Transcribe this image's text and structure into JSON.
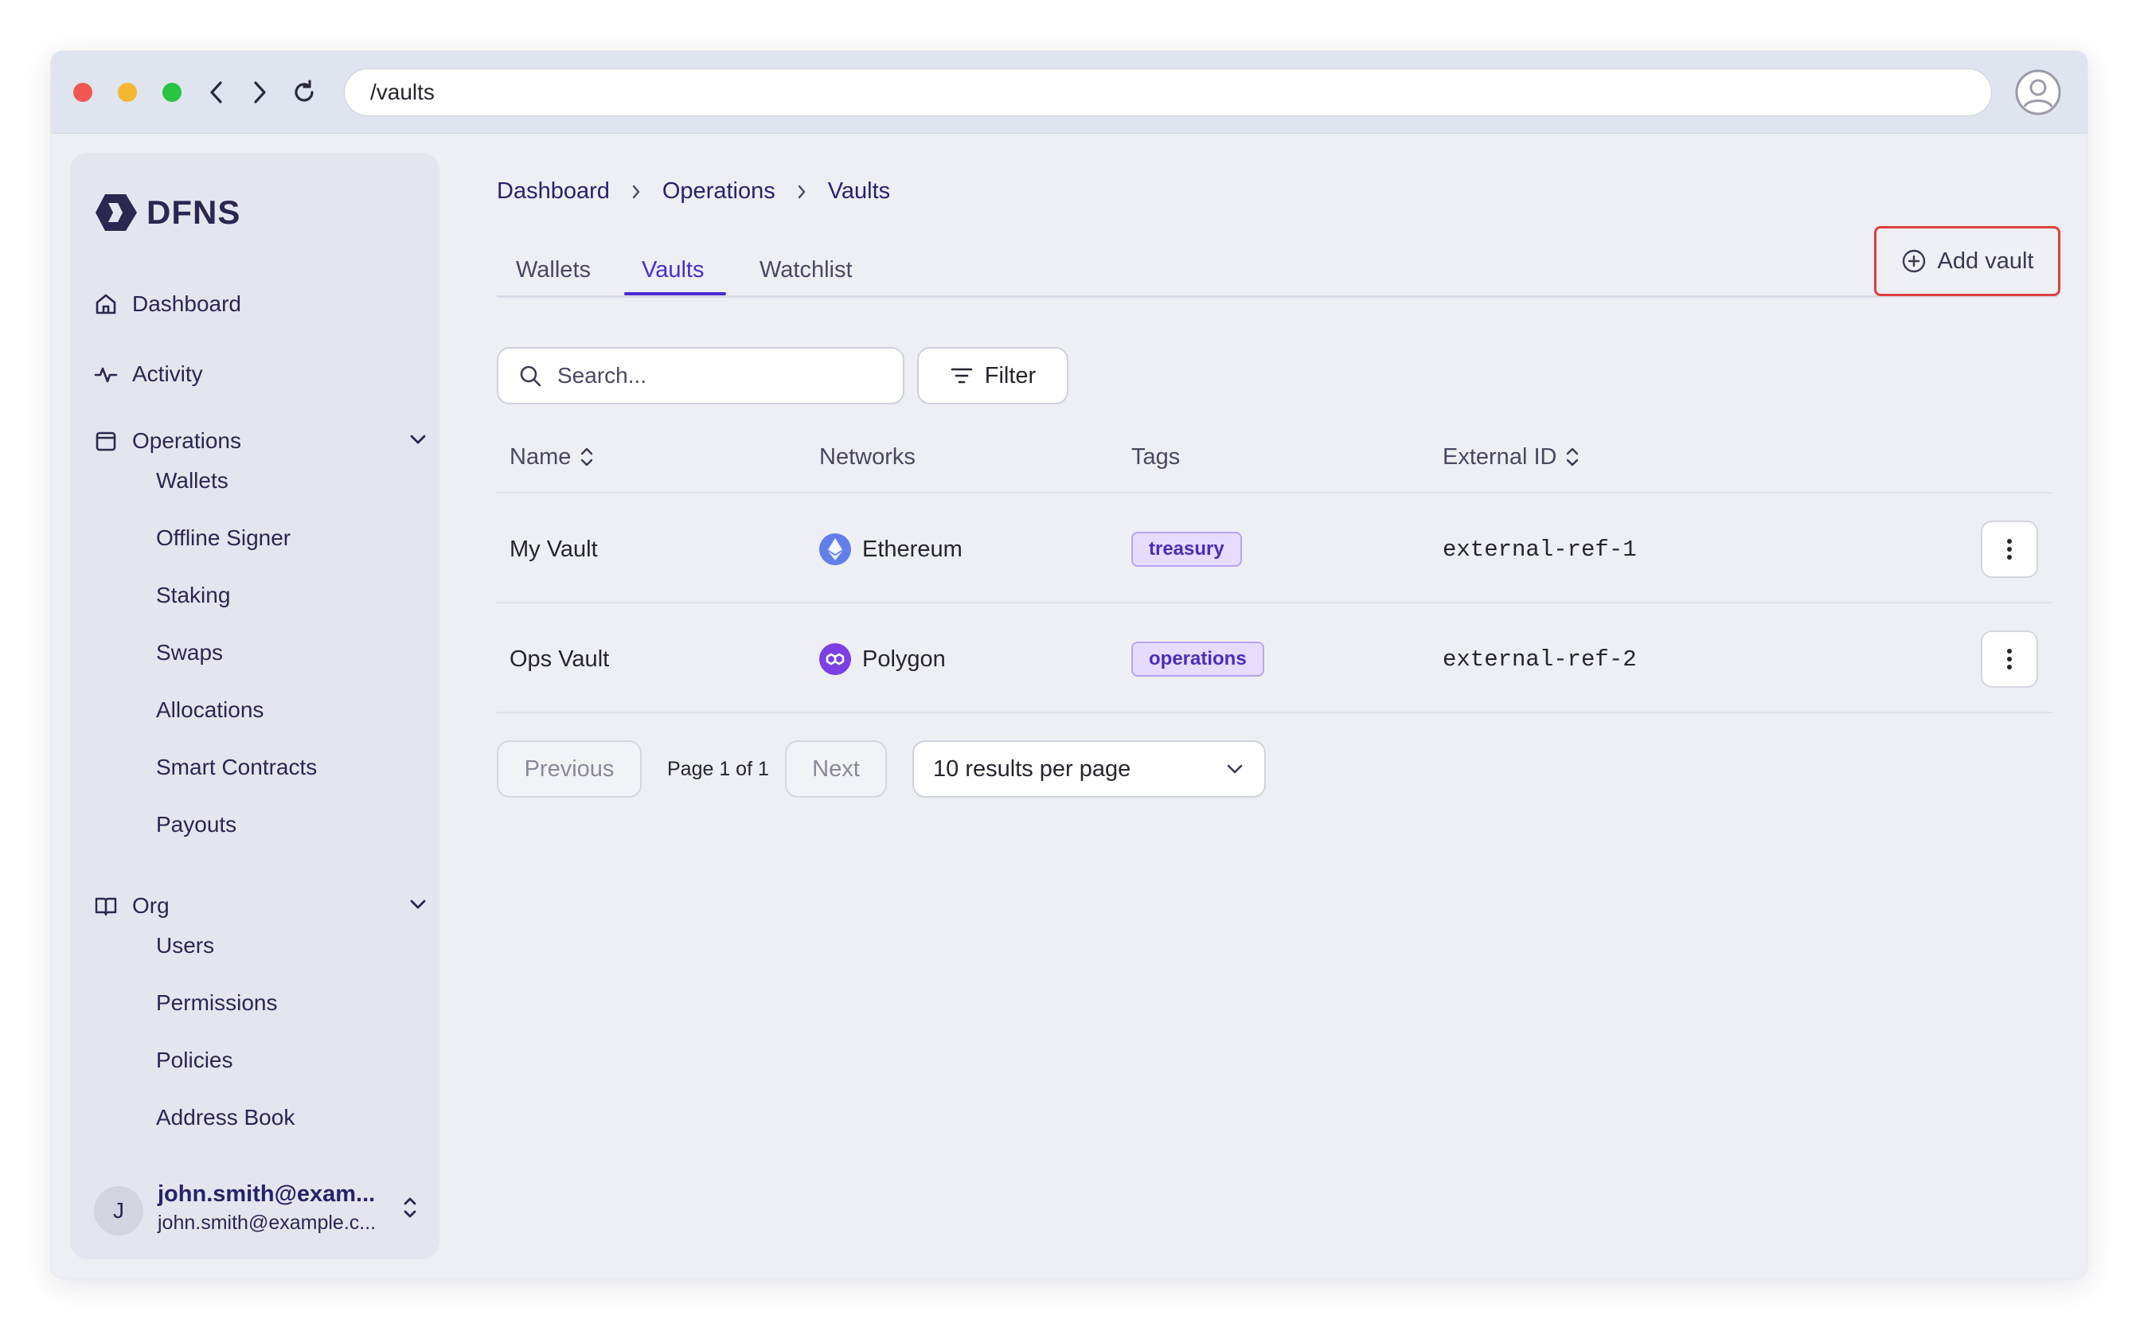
{
  "browser": {
    "url": "/vaults",
    "colors": {
      "close": "#f0574f",
      "minimize": "#f5b731",
      "maximize": "#28c540"
    }
  },
  "brand": {
    "name": "DFNS"
  },
  "sidebar": {
    "items": [
      {
        "label": "Dashboard",
        "icon": "home-icon"
      },
      {
        "label": "Activity",
        "icon": "activity-icon"
      },
      {
        "label": "Operations",
        "icon": "wallet-icon",
        "expanded": true,
        "children": [
          "Wallets",
          "Offline Signer",
          "Staking",
          "Swaps",
          "Allocations",
          "Smart Contracts",
          "Payouts"
        ]
      },
      {
        "label": "Org",
        "icon": "book-icon",
        "expanded": true,
        "children": [
          "Users",
          "Permissions",
          "Policies",
          "Address Book"
        ]
      }
    ],
    "user": {
      "initial": "J",
      "name": "john.smith@exam...",
      "email": "john.smith@example.c..."
    }
  },
  "breadcrumb": [
    "Dashboard",
    "Operations",
    "Vaults"
  ],
  "tabs": [
    {
      "label": "Wallets",
      "active": false
    },
    {
      "label": "Vaults",
      "active": true
    },
    {
      "label": "Watchlist",
      "active": false
    }
  ],
  "actions": {
    "add_vault": "Add vault",
    "filter": "Filter"
  },
  "search": {
    "placeholder": "Search..."
  },
  "table": {
    "columns": [
      "Name",
      "Networks",
      "Tags",
      "External ID"
    ],
    "rows": [
      {
        "name": "My Vault",
        "network": "Ethereum",
        "network_icon": "ethereum-icon",
        "tag": "treasury",
        "external_id": "external-ref-1"
      },
      {
        "name": "Ops Vault",
        "network": "Polygon",
        "network_icon": "polygon-icon",
        "tag": "operations",
        "external_id": "external-ref-2"
      }
    ]
  },
  "pagination": {
    "previous": "Previous",
    "page_text": "Page 1 of 1",
    "next": "Next",
    "per_page": "10 results per page"
  },
  "colors": {
    "accent": "#4b2bd0",
    "highlight_border": "#e0403f",
    "tag_bg": "#e5dcff"
  }
}
